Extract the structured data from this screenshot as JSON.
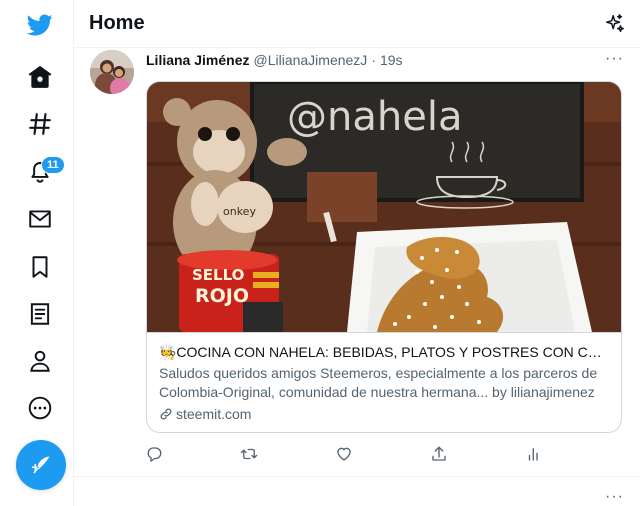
{
  "nav": {
    "items": [
      {
        "icon": "twitter-bird-icon"
      },
      {
        "icon": "home-icon"
      },
      {
        "icon": "hashtag-icon"
      },
      {
        "icon": "bell-icon",
        "badge": "11"
      },
      {
        "icon": "envelope-icon"
      },
      {
        "icon": "bookmark-icon"
      },
      {
        "icon": "list-icon"
      },
      {
        "icon": "person-icon"
      },
      {
        "icon": "more-circle-icon"
      }
    ],
    "compose_icon": "feather-plus-icon",
    "accent": "#1d9bf0"
  },
  "header": {
    "title": "Home",
    "sparkle_icon": "sparkle-icon"
  },
  "tweet": {
    "display_name": "Liliana Jiménez",
    "handle": "@LilianaJimenezJ",
    "separator": "·",
    "time": "19s",
    "more": "···",
    "card": {
      "image_text": "@nahela",
      "title": "🧑‍🍳COCINA CON NAHELA: BEBIDAS, PLATOS Y POSTRES CON CAF...",
      "description": "Saludos queridos amigos Steemeros, especialmente a los parceros de Colombia-Original, comunidad de nuestra hermana... by lilianajimenez",
      "domain": "steemit.com"
    },
    "actions": [
      "reply-icon",
      "retweet-icon",
      "like-icon",
      "share-icon",
      "analytics-icon"
    ]
  },
  "next_tweet": {
    "more": "···"
  }
}
